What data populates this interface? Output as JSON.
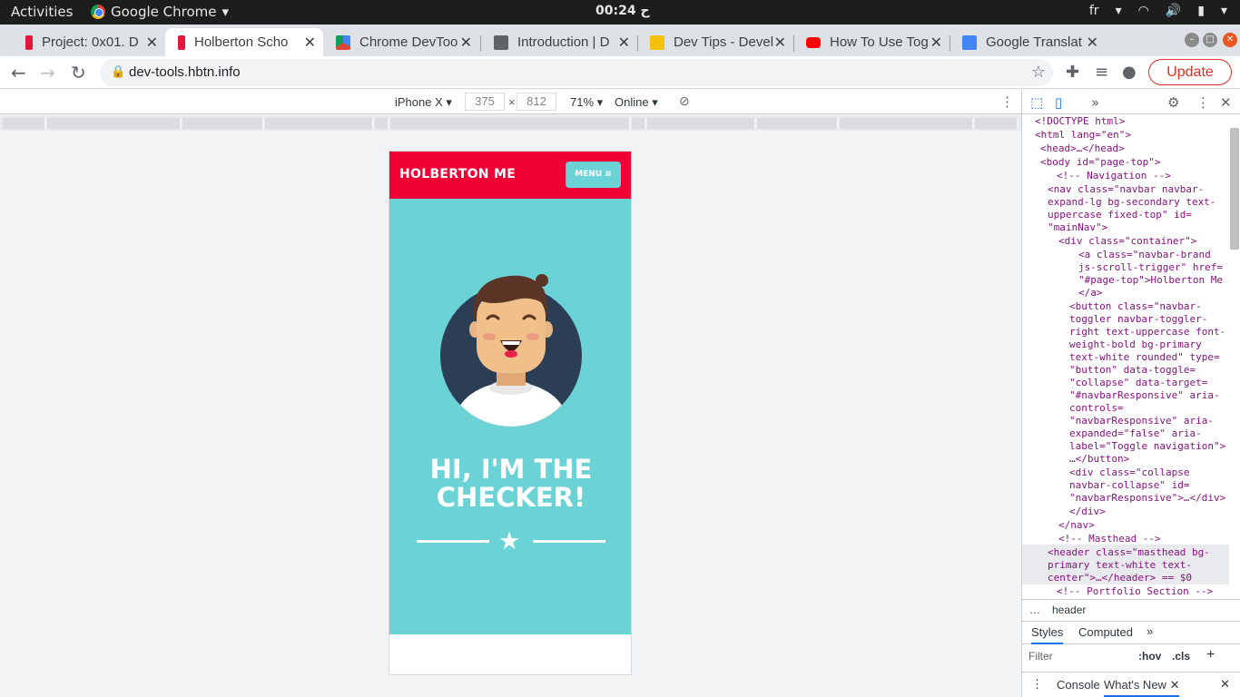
{
  "os_bar": {
    "activities": "Activities",
    "app_name": "Google Chrome",
    "clock": "00:24 ح",
    "lang": "fr"
  },
  "tabs": [
    {
      "title": "Project: 0x01. D",
      "favicon_color": "#e3173e"
    },
    {
      "title": "Holberton Scho",
      "favicon_color": "#e3173e"
    },
    {
      "title": "Chrome DevToo",
      "favicon_color": "#4285f4"
    },
    {
      "title": "Introduction | D",
      "favicon_color": "#5f6368"
    },
    {
      "title": "Dev Tips - Devel",
      "favicon_color": "#f4c20d"
    },
    {
      "title": "How To Use Tog",
      "favicon_color": "#ff0000"
    },
    {
      "title": "Google Translat",
      "favicon_color": "#4285f4"
    }
  ],
  "omnibar": {
    "url": "dev-tools.hbtn.info",
    "update_label": "Update"
  },
  "device_toolbar": {
    "device": "iPhone X",
    "width": "375",
    "height": "812",
    "zoom": "71%",
    "throttle": "Online"
  },
  "page": {
    "brand": "HOLBERTON ME",
    "menu_label": "MENU ≡",
    "heading": "HI, I'M THE CHECKER!",
    "nav_color": "#ef0035",
    "primary_color": "#6bd2d6"
  },
  "devtools": {
    "dom": [
      "<!DOCTYPE html>",
      "<html lang=\"en\">",
      "<head>…</head>",
      "<body id=\"page-top\">",
      "<!-- Navigation -->",
      "<nav class=\"navbar navbar-",
      "expand-lg bg-secondary text-",
      "uppercase fixed-top\" id=",
      "\"mainNav\">",
      "<div class=\"container\">",
      "<a class=\"navbar-brand",
      "js-scroll-trigger\" href=",
      "\"#page-top\">Holberton Me",
      "</a>",
      "<button class=\"navbar-",
      "toggler navbar-toggler-",
      "right text-uppercase font-",
      "weight-bold bg-primary",
      "text-white rounded\" type=",
      "\"button\" data-toggle=",
      "\"collapse\" data-target=",
      "\"#navbarResponsive\" aria-",
      "controls=",
      "\"navbarResponsive\" aria-",
      "expanded=\"false\" aria-",
      "label=\"Toggle navigation\">",
      "…</button>",
      "<div class=\"collapse",
      "navbar-collapse\" id=",
      "\"navbarResponsive\">…</div>",
      "</div>",
      "</nav>",
      "<!-- Masthead -->",
      "<header class=\"masthead bg-",
      "primary text-white text-",
      "center\">…</header> == $0",
      "<!-- Portfolio Section -->"
    ],
    "breadcrumb": "header",
    "styles_tab": "Styles",
    "computed_tab": "Computed",
    "filter_placeholder": "Filter",
    "hov": ":hov",
    "cls": ".cls",
    "console_tab": "Console",
    "whats_new_tab": "What's New"
  }
}
